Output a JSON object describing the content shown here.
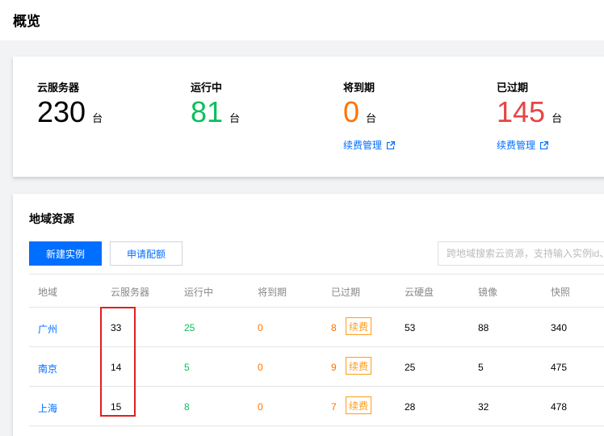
{
  "page": {
    "title": "概览"
  },
  "overview": {
    "stats": [
      {
        "label": "云服务器",
        "value": "230",
        "unit": "台",
        "color": "#000000"
      },
      {
        "label": "运行中",
        "value": "81",
        "unit": "台",
        "color": "#0abf5b"
      },
      {
        "label": "将到期",
        "value": "0",
        "unit": "台",
        "color": "#ff7200",
        "link": "续费管理"
      },
      {
        "label": "已过期",
        "value": "145",
        "unit": "台",
        "color": "#e54545",
        "link": "续费管理"
      }
    ]
  },
  "region": {
    "title": "地域资源",
    "new_button": "新建实例",
    "quota_button": "申请配额",
    "search_placeholder": "跨地域搜索云资源，支持输入实例id、",
    "columns": [
      "地域",
      "云服务器",
      "运行中",
      "将到期",
      "已过期",
      "云硬盘",
      "镜像",
      "快照"
    ],
    "renew_label": "续费",
    "rows": [
      {
        "region": "广州",
        "servers": "33",
        "running": "25",
        "expiring": "0",
        "expired": "8",
        "disks": "53",
        "images": "88",
        "snapshots": "340"
      },
      {
        "region": "南京",
        "servers": "14",
        "running": "5",
        "expiring": "0",
        "expired": "9",
        "disks": "25",
        "images": "5",
        "snapshots": "475"
      },
      {
        "region": "上海",
        "servers": "15",
        "running": "8",
        "expiring": "0",
        "expired": "7",
        "disks": "28",
        "images": "32",
        "snapshots": "478"
      }
    ]
  },
  "colors": {
    "accent": "#006eff",
    "running": "#0abf5b",
    "warning": "#ff7200",
    "danger": "#e54545",
    "highlight": "#e02020"
  },
  "icons": {
    "external_link": "external-link-icon"
  }
}
